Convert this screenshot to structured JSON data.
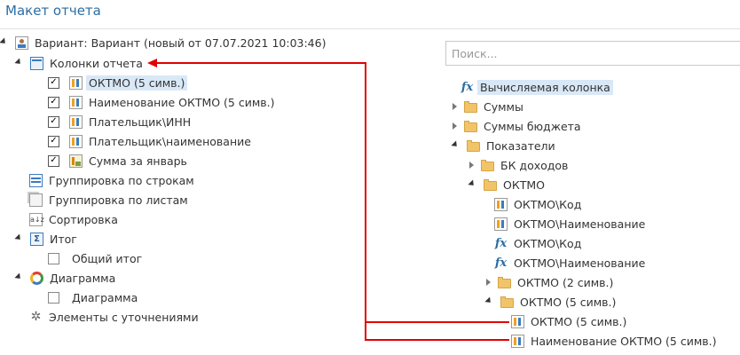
{
  "title": "Макет отчета",
  "left_tree": {
    "variant": "Вариант: Вариант (новый от 07.07.2021 10:03:46)",
    "columns_group": "Колонки отчета",
    "columns": [
      {
        "label": "ОКТМО (5 симв.)",
        "checked": true,
        "selected": true,
        "icon": "column-icon"
      },
      {
        "label": "Наименование ОКТМО (5 симв.)",
        "checked": true,
        "icon": "column-icon"
      },
      {
        "label": "Плательщик\\ИНН",
        "checked": true,
        "icon": "column-icon"
      },
      {
        "label": "Плательщик\\наименование",
        "checked": true,
        "icon": "column-icon"
      },
      {
        "label": "Сумма за январь",
        "checked": true,
        "icon": "sum-column-icon"
      }
    ],
    "group_rows": "Группировка по строкам",
    "group_sheets": "Группировка по листам",
    "sorting": "Сортировка",
    "total": "Итог",
    "total_child": "Общий итог",
    "chart": "Диаграмма",
    "chart_child": "Диаграмма",
    "refined": "Элементы с уточнениями"
  },
  "search": {
    "placeholder": "Поиск..."
  },
  "right_tree": {
    "computed": "Вычисляемая колонка",
    "sums": "Суммы",
    "budget_sums": "Суммы бюджета",
    "indicators": "Показатели",
    "bk_income": "БК доходов",
    "oktmo": "ОКТМО",
    "oktmo_code": "ОКТМО\\Код",
    "oktmo_name": "ОКТМО\\Наименование",
    "oktmo_code_fx": "ОКТМО\\Код",
    "oktmo_name_fx": "ОКТМО\\Наименование",
    "oktmo_2": "ОКТМО (2 симв.)",
    "oktmo_5": "ОКТМО (5 симв.)",
    "oktmo_5_item": "ОКТМО (5 симв.)",
    "oktmo_5_name": "Наименование ОКТМО (5 симв.)"
  },
  "colors": {
    "accent": "#2d6da3",
    "selection": "#d9e8f7",
    "annotation": "#e00000"
  }
}
